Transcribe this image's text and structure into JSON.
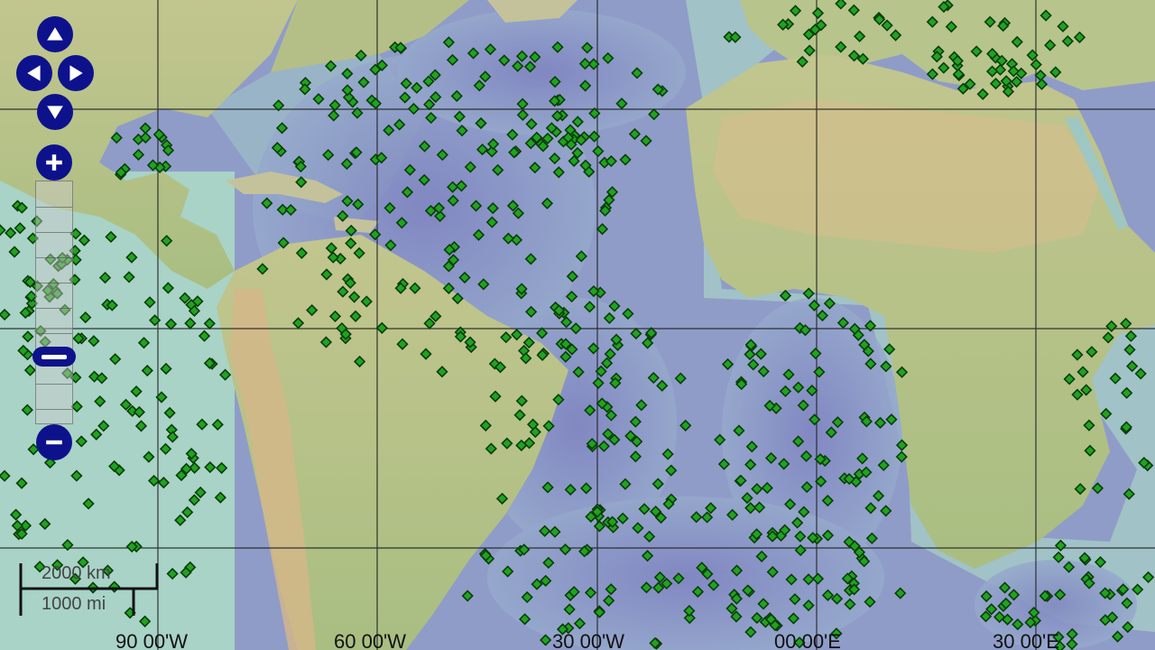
{
  "map": {
    "lon_labels": [
      "90 00'W",
      "60 00'W",
      "30 00'W",
      "00 00'E",
      "30 00'E"
    ],
    "markers": {
      "count_visible": 0,
      "color": "#1fa41f",
      "edge": "#0b3b0b"
    },
    "colors": {
      "land": "#b9c18c",
      "ocean_shallow": "#a9d1c9",
      "ocean_deep": "#8c8fc4",
      "desert": "#d9b98d",
      "grid": "#1b1b1b"
    }
  },
  "controls": {
    "pan": [
      "pan-up-icon",
      "pan-left-icon",
      "pan-right-icon",
      "pan-down-icon"
    ],
    "zoom_in": "zoom-in-icon",
    "zoom_out": "zoom-out-icon",
    "color": "#0d128c"
  },
  "scale": {
    "km_label": "2000 km",
    "mi_label": "1000 mi"
  }
}
